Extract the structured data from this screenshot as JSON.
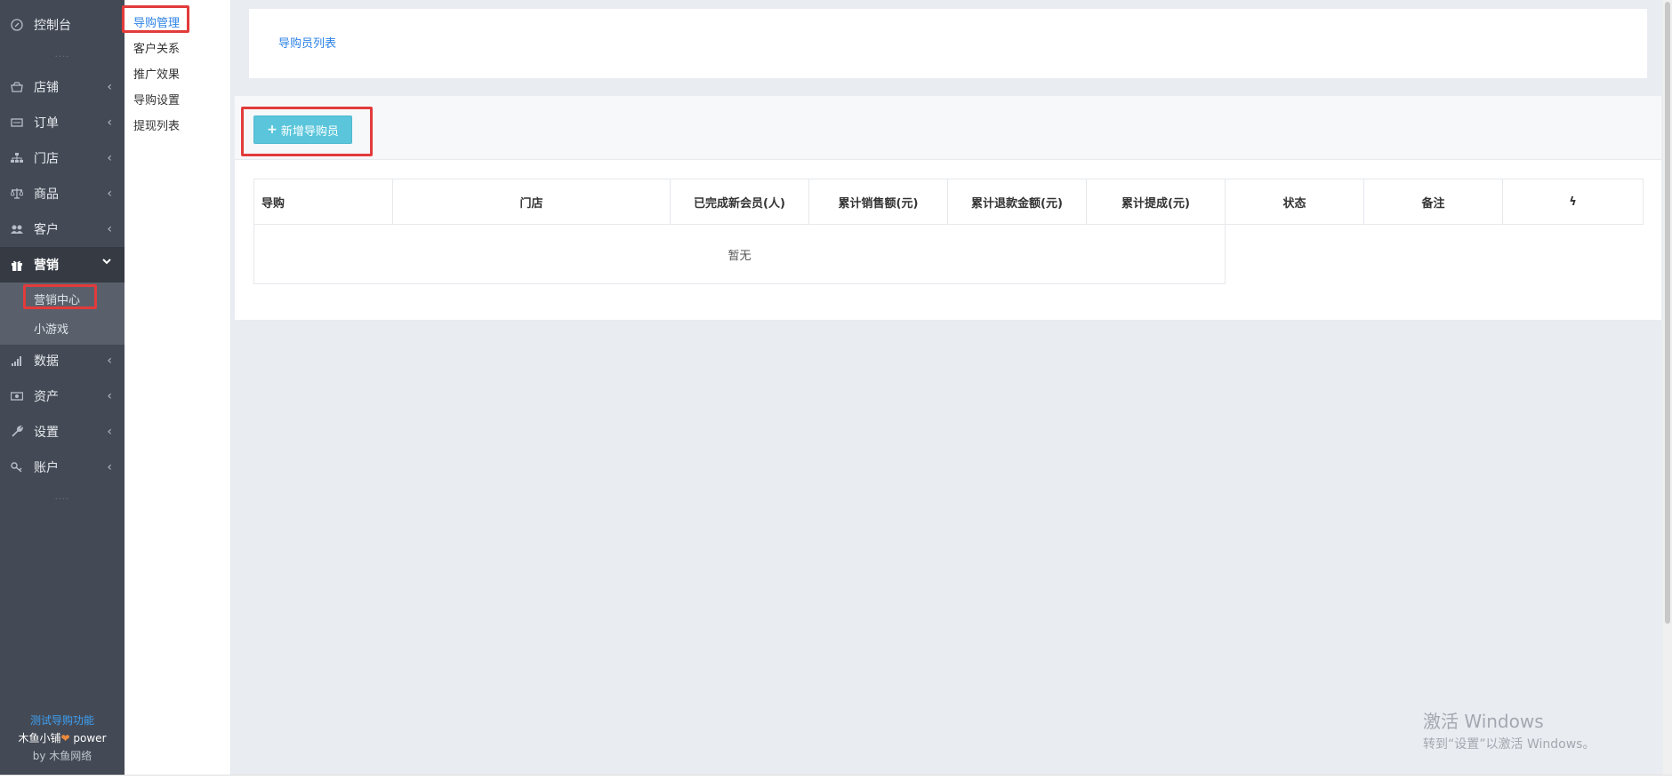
{
  "sidebar": {
    "dashboard": "控制台",
    "items": [
      {
        "label": "店铺",
        "icon": "store-icon"
      },
      {
        "label": "订单",
        "icon": "order-icon"
      },
      {
        "label": "门店",
        "icon": "sitemap-icon"
      },
      {
        "label": "商品",
        "icon": "scale-icon"
      },
      {
        "label": "客户",
        "icon": "users-icon"
      },
      {
        "label": "营销",
        "icon": "gift-icon"
      },
      {
        "label": "数据",
        "icon": "bar-chart-icon"
      },
      {
        "label": "资产",
        "icon": "money-icon"
      },
      {
        "label": "设置",
        "icon": "wrench-icon"
      },
      {
        "label": "账户",
        "icon": "key-icon"
      }
    ],
    "marketing_sub": [
      "营销中心",
      "小游戏"
    ],
    "dots": "....",
    "footer": {
      "line1": "测试导购功能",
      "line2_a": "木鱼小铺",
      "line2_b": "power",
      "line3_a": "by",
      "line3_b": "木鱼网络"
    }
  },
  "secondary_nav": [
    "导购管理",
    "客户关系",
    "推广效果",
    "导购设置",
    "提现列表"
  ],
  "tabs": {
    "active": "导购员列表"
  },
  "toolbar": {
    "add_button": "新增导购员"
  },
  "table": {
    "headers": [
      "导购",
      "门店",
      "已完成新会员(人)",
      "累计销售额(元)",
      "累计退款金额(元)",
      "累计提成(元)",
      "状态",
      "备注",
      "ϟ"
    ],
    "empty_text": "暂无"
  },
  "watermark": {
    "title": "激活 Windows",
    "subtitle": "转到“设置”以激活 Windows。"
  }
}
